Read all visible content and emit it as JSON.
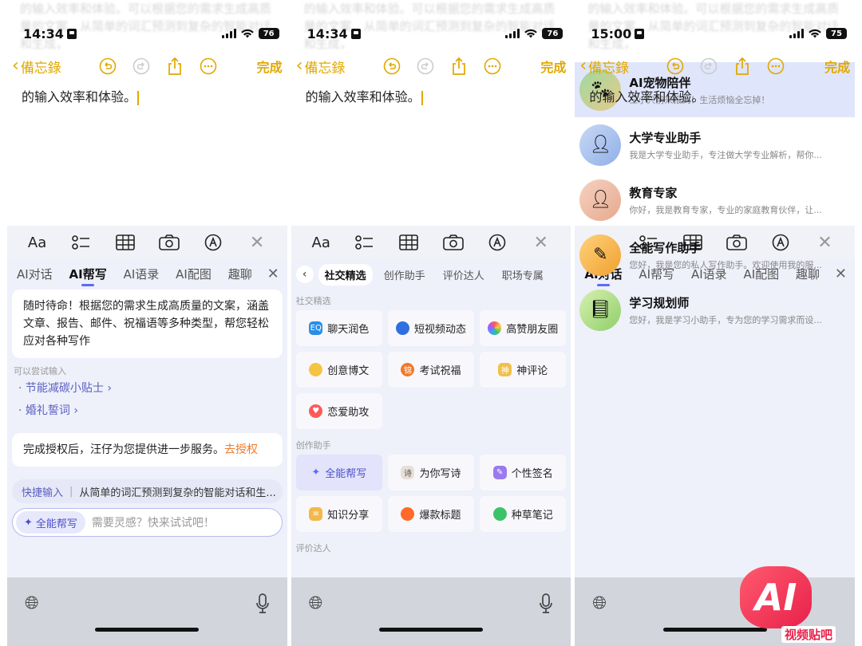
{
  "status": [
    {
      "time": "14:34",
      "battery": "76"
    },
    {
      "time": "14:34",
      "battery": "76"
    },
    {
      "time": "15:00",
      "battery": "75"
    }
  ],
  "nav": {
    "back_label": "備忘錄",
    "done_label": "完成"
  },
  "note": {
    "text": "的输入效率和体验。"
  },
  "ghost_text": "的输入效率和体验。可以根据您的需求生成高质量的文案，从简单的词汇预测到复杂的智能对话和生成，",
  "tools": {
    "font": "Aa",
    "checklist": "checklist-icon",
    "table": "table-icon",
    "camera": "camera-icon",
    "markup": "markup-icon",
    "close": "close-icon"
  },
  "tabs": [
    "AI对话",
    "AI帮写",
    "AI语录",
    "AI配图",
    "趣聊"
  ],
  "panel1": {
    "active_tab": "AI帮写",
    "intro": "随时待命！根据您的需求生成高质量的文案，涵盖文章、报告、邮件、祝福语等多种类型，帮您轻松应对各种写作",
    "hint": "可以尝试输入",
    "suggestions": [
      "· 节能减碳小贴士 ›",
      "· 婚礼誓词 ›"
    ],
    "auth_text": "完成授权后，汪仔为您提供进一步服务。",
    "auth_link": "去授权",
    "quick_label": "快捷输入",
    "quick_text": "从简单的词汇预测到复杂的智能对话和生...",
    "input_pill": "全能帮写",
    "input_placeholder": "需要灵感？快来试试吧！"
  },
  "panel2": {
    "cat_tabs": [
      "社交精选",
      "创作助手",
      "评价达人",
      "职场专属"
    ],
    "sec1": "社交精选",
    "items1": [
      "聊天润色",
      "短视频动态",
      "高赞朋友圈",
      "创意博文",
      "考试祝福",
      "神评论",
      "恋爱助攻"
    ],
    "sec2": "创作助手",
    "items2": [
      "全能帮写",
      "为你写诗",
      "个性签名",
      "知识分享",
      "爆款标题",
      "种草笔记"
    ],
    "sec3": "评价达人"
  },
  "panel3": {
    "active_tab": "AI对话",
    "assistants": [
      {
        "name": "AI宠物陪伴",
        "desc": "三小只前来报到！生活烦恼全忘掉！"
      },
      {
        "name": "大学专业助手",
        "desc": "我是大学专业助手，专注做大学专业解析，帮你..."
      },
      {
        "name": "教育专家",
        "desc": "你好，我是教育专家，专业的家庭教育伙伴，让..."
      },
      {
        "name": "全能写作助手",
        "desc": "您好，我是您的私人写作助手。欢迎使用我的服..."
      },
      {
        "name": "学习规划师",
        "desc": "您好，我是学习小助手，专为您的学习需求而设..."
      }
    ]
  },
  "watermark": {
    "logo": "AI",
    "text": "视频贴吧"
  }
}
